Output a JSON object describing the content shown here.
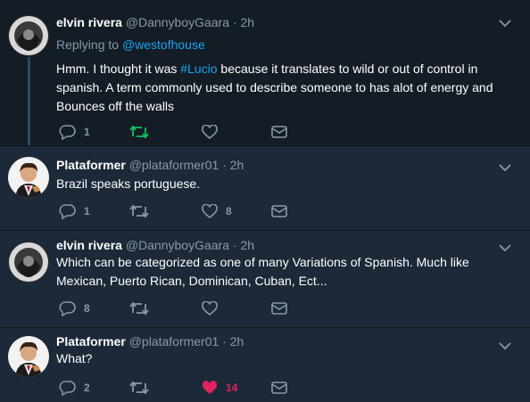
{
  "tweets": [
    {
      "name": "elvin rivera",
      "handle": "@DannyboyGaara",
      "sep": "·",
      "time": "2h",
      "replying_prefix": "Replying to",
      "replying_to": "@westofhouse",
      "text_pre": "Hmm. I thought it was ",
      "hashtag": "#Lucio",
      "text_post": " because it translates to wild or out of control in spanish. A term commonly used to describe someone to has alot of energy and Bounces off the walls",
      "reply_count": "1",
      "retweet_count": "",
      "like_count": "",
      "retweet_color": "#17bf63"
    },
    {
      "name": "Plataformer",
      "handle": "@plataformer01",
      "sep": "·",
      "time": "2h",
      "text": "Brazil speaks portuguese.",
      "reply_count": "1",
      "retweet_count": "",
      "like_count": "8"
    },
    {
      "name": "elvin rivera",
      "handle": "@DannyboyGaara",
      "sep": "·",
      "time": "2h",
      "text": "Which can be categorized as one of many Variations of Spanish. Much like Mexican, Puerto Rican, Dominican, Cuban, Ect...",
      "reply_count": "8",
      "retweet_count": "",
      "like_count": ""
    },
    {
      "name": "Plataformer",
      "handle": "@plataformer01",
      "sep": "·",
      "time": "2h",
      "text": "What?",
      "reply_count": "2",
      "retweet_count": "",
      "like_count": "14",
      "like_color": "#e0245e"
    }
  ],
  "colors": {
    "highlight_bg": "#141d26",
    "bg": "#1c2938",
    "link": "#1da1f2",
    "muted": "#8899a6"
  },
  "icons": [
    "reply-icon",
    "retweet-icon",
    "like-icon",
    "message-icon",
    "chevron-down-icon"
  ]
}
